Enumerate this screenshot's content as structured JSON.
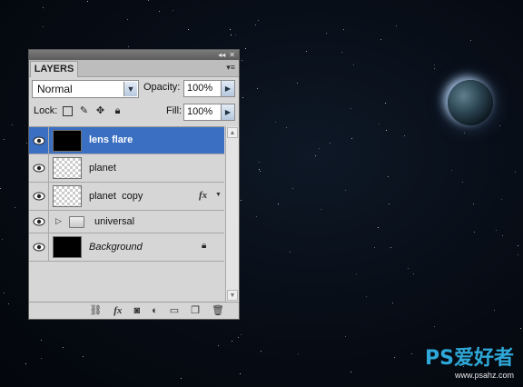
{
  "panel": {
    "tab_label": "LAYERS",
    "blend_mode": "Normal",
    "opacity_label": "Opacity:",
    "opacity_value": "100%",
    "lock_label": "Lock:",
    "fill_label": "Fill:",
    "fill_value": "100%"
  },
  "layers": [
    {
      "name": "lens flare",
      "selected": true,
      "thumb": "black",
      "visible": true
    },
    {
      "name": "planet",
      "selected": false,
      "thumb": "transparent",
      "visible": true
    },
    {
      "name": "planet  copy",
      "selected": false,
      "thumb": "transparent",
      "visible": true,
      "effects": "fx"
    },
    {
      "name": "universal",
      "selected": false,
      "type": "group",
      "visible": true
    },
    {
      "name": "Background",
      "selected": false,
      "thumb": "black",
      "visible": true,
      "locked": true
    }
  ],
  "footer_icons": [
    "link-icon",
    "fx-icon",
    "mask-icon",
    "adjustment-icon",
    "folder-icon",
    "new-layer-icon",
    "trash-icon"
  ],
  "watermark": {
    "logo": "PS爱好者",
    "url": "www.psahz.com"
  },
  "colors": {
    "selection": "#3a6fc2",
    "panel": "#d6d6d6",
    "background": "#070c15"
  }
}
